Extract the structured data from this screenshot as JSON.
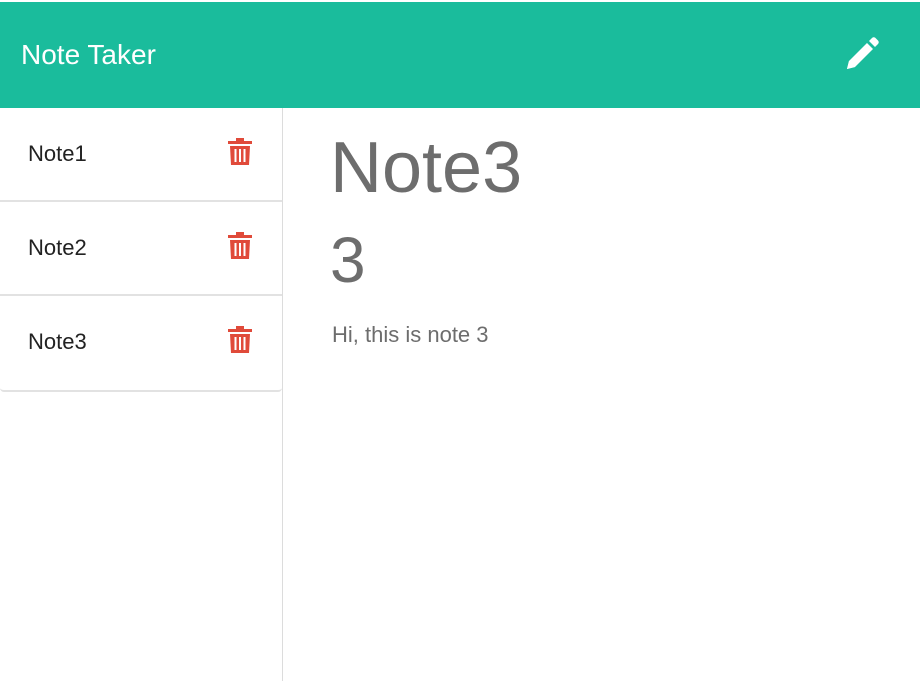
{
  "app": {
    "title": "Note Taker",
    "new_note_icon": "pencil-icon"
  },
  "colors": {
    "header": "#1abc9c",
    "delete_icon": "#e04a3a",
    "text_muted": "#6d6d6d"
  },
  "notes": [
    {
      "title": "Note1",
      "delete_icon": "trash-icon"
    },
    {
      "title": "Note2",
      "delete_icon": "trash-icon"
    },
    {
      "title": "Note3",
      "delete_icon": "trash-icon"
    }
  ],
  "active_note": {
    "title": "Note3",
    "number": "3",
    "text": "Hi, this is note 3"
  }
}
